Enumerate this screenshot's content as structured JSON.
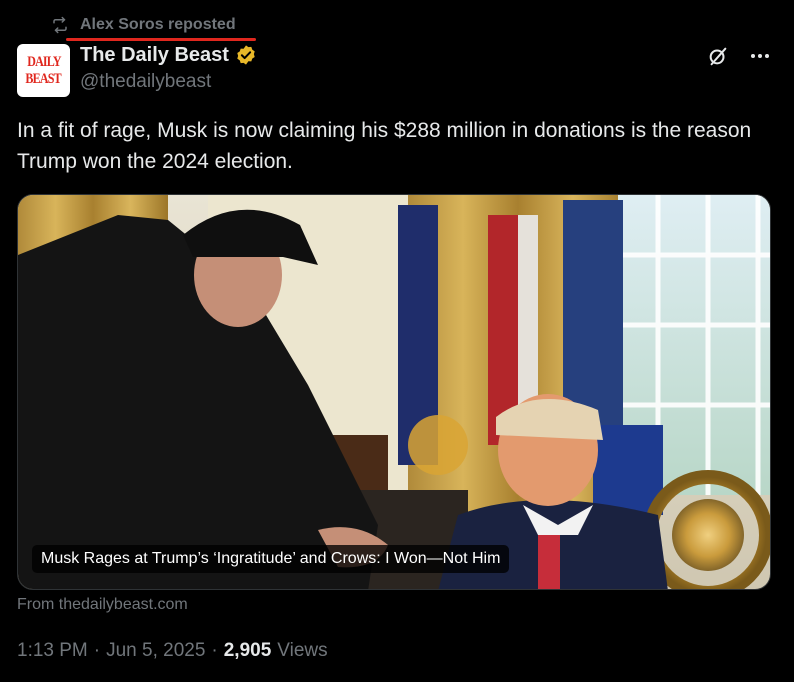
{
  "repost": {
    "text": "Alex Soros reposted",
    "icon": "repost-icon",
    "underline_color": "#e0271e"
  },
  "author": {
    "avatar_lines": [
      "DAILY",
      "BEAST"
    ],
    "name": "The Daily Beast",
    "handle": "@thedailybeast",
    "verified_icon": "verified-gold-badge-icon",
    "verified_color": "#e8b829"
  },
  "actions": {
    "grok_icon": "grok-icon",
    "more_icon": "more-icon"
  },
  "tweet": {
    "text": "In a fit of rage, Musk is now claiming his $288 million in donations is the reason Trump won the 2024 election."
  },
  "media": {
    "caption": "Musk Rages at Trump’s ‘Ingratitude’ and Crows: I Won—Not Him"
  },
  "source": {
    "text": "From thedailybeast.com"
  },
  "meta": {
    "time": "1:13 PM",
    "date": "Jun 5, 2025",
    "views_count": "2,905",
    "views_label": "Views",
    "separator": "·"
  },
  "colors": {
    "background": "#000000",
    "text_primary": "#e7e9ea",
    "text_secondary": "#71767b",
    "accent_red": "#e0271e"
  }
}
